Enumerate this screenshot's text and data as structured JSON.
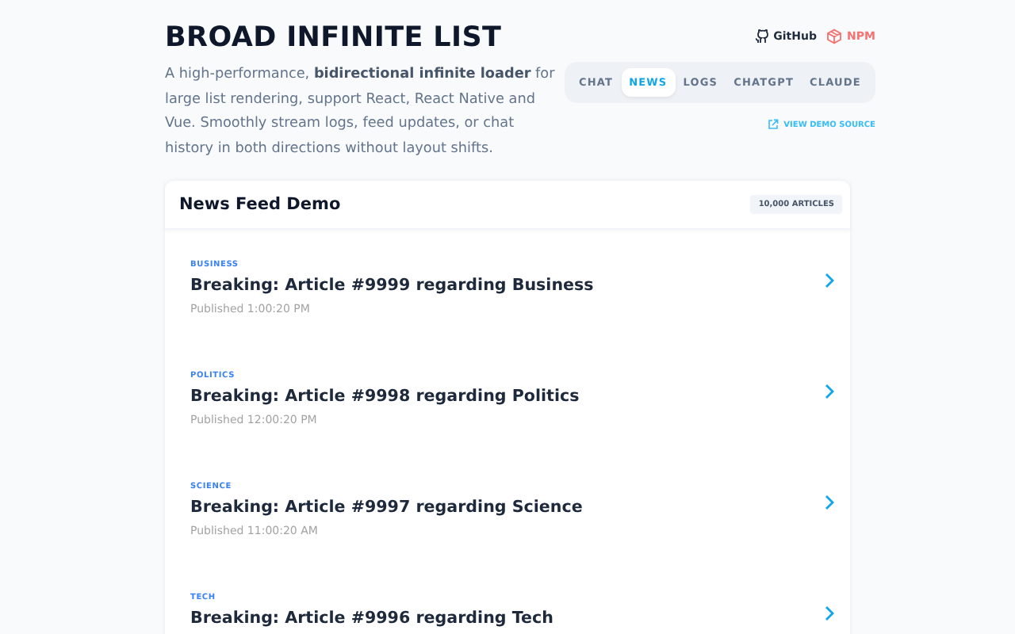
{
  "header": {
    "title": "BROAD INFINITE LIST",
    "description": "A high-performance, **bidirectional infinite loader** for large list rendering, support React, React Native and Vue. Smoothly stream logs, feed updates, or chat history in both directions without layout shifts.",
    "links": [
      {
        "kind": "github",
        "label": "GitHub"
      },
      {
        "kind": "npm",
        "label": "NPM"
      }
    ],
    "demo_source": "VIEW DEMO SOURCE"
  },
  "tabs": [
    {
      "label": "CHAT",
      "selected": false
    },
    {
      "label": "NEWS",
      "selected": true
    },
    {
      "label": "LOGS",
      "selected": false
    },
    {
      "label": "CHATGPT",
      "selected": false
    },
    {
      "label": "CLAUDE",
      "selected": false
    }
  ],
  "feed": {
    "title": "News Feed Demo",
    "count": "10,000 ARTICLES",
    "items": [
      {
        "category": "BUSINESS",
        "title": "Breaking: Article #9999 regarding Business",
        "published": "Published 1:00:20 PM"
      },
      {
        "category": "POLITICS",
        "title": "Breaking: Article #9998 regarding Politics",
        "published": "Published 12:00:20 PM"
      },
      {
        "category": "SCIENCE",
        "title": "Breaking: Article #9997 regarding Science",
        "published": "Published 11:00:20 AM"
      },
      {
        "category": "TECH",
        "title": "Breaking: Article #9996 regarding Tech"
      }
    ]
  }
}
